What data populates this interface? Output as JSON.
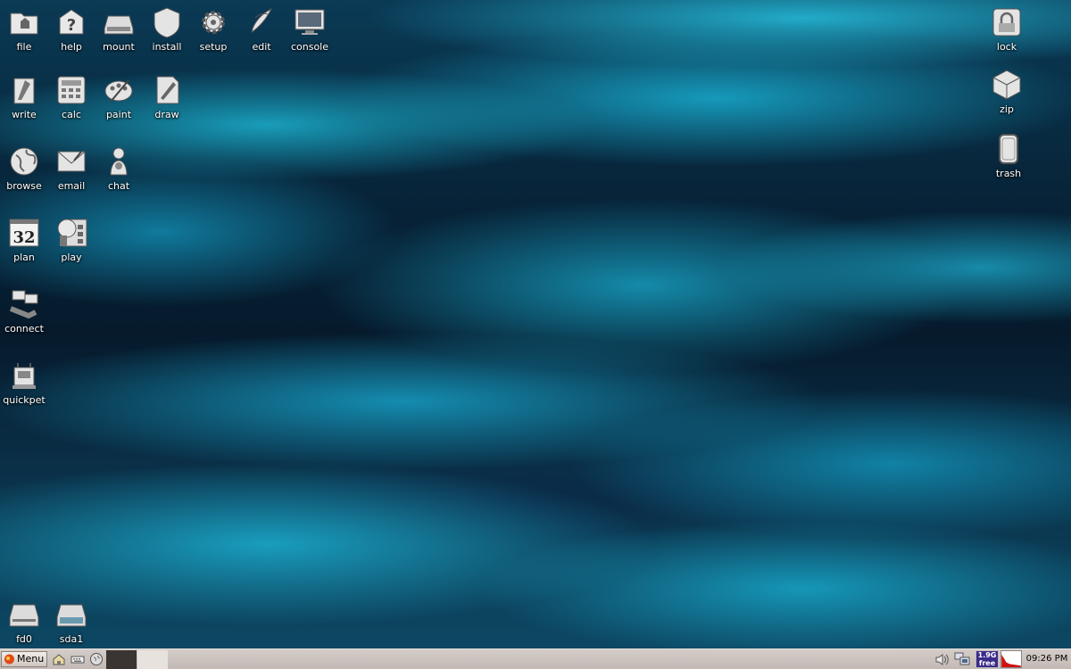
{
  "desktop_icons": {
    "file": "file",
    "help": "help",
    "mount": "mount",
    "install": "install",
    "setup": "setup",
    "edit": "edit",
    "console": "console",
    "write": "write",
    "calc": "calc",
    "paint": "paint",
    "draw": "draw",
    "browse": "browse",
    "email": "email",
    "chat": "chat",
    "plan": "plan",
    "plan_date": "32",
    "play": "play",
    "connect": "connect",
    "quickpet": "quickpet",
    "lock": "lock",
    "zip": "zip",
    "trash": "trash",
    "fd0": "fd0",
    "sda1": "sda1"
  },
  "taskbar": {
    "menu_label": "Menu",
    "free_space": "1.9G",
    "free_label": "free",
    "clock": "09:26 PM"
  },
  "colors": {
    "background": "#0a3a55",
    "taskbar": "#c8bfba",
    "free_space_bg": "#3b2a8a"
  }
}
